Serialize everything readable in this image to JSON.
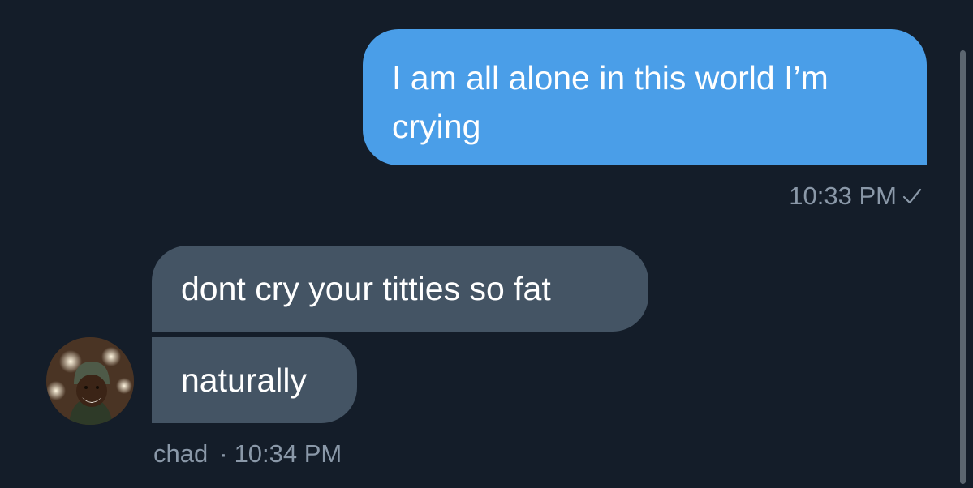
{
  "conversation": {
    "outgoing": {
      "text": "I am all alone in this world I’m crying",
      "time": "10:33 PM",
      "status_icon": "check-icon"
    },
    "incoming": {
      "messages": [
        "dont cry your titties so fat",
        "naturally"
      ],
      "sender": "chad",
      "separator": "·",
      "time": "10:34 PM",
      "avatar": "user-avatar-photo"
    }
  },
  "colors": {
    "background": "#141d29",
    "outgoing_bubble": "#4a9ee8",
    "incoming_bubble": "#445464",
    "meta_text": "#8a98a8"
  }
}
